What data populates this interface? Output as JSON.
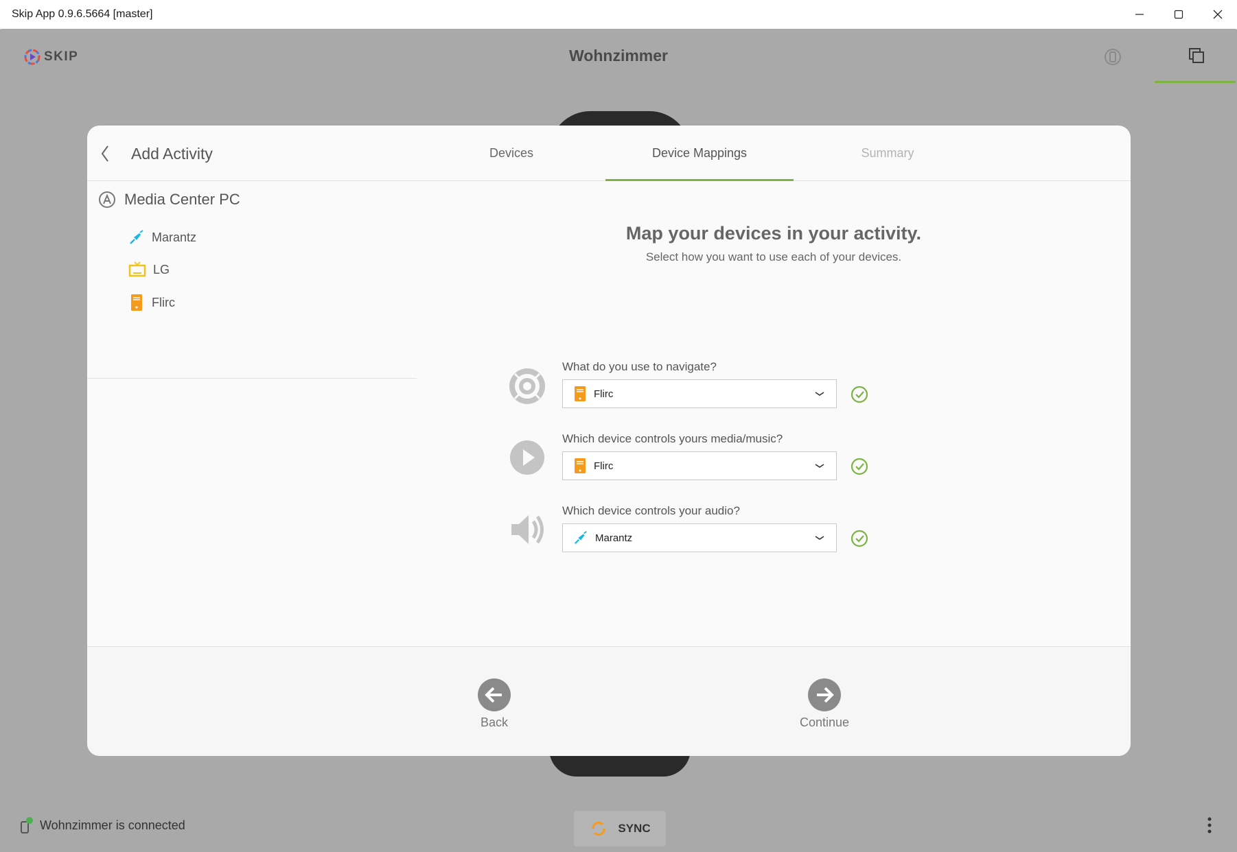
{
  "window": {
    "title": "Skip App 0.9.6.5664 [master]"
  },
  "header": {
    "logo_text": "SKIP",
    "room": "Wohnzimmer"
  },
  "modal": {
    "title": "Add Activity",
    "tabs": [
      {
        "label": "Devices",
        "state": "normal"
      },
      {
        "label": "Device Mappings",
        "state": "active"
      },
      {
        "label": "Summary",
        "state": "disabled"
      }
    ],
    "activity": {
      "name": "Media Center PC"
    },
    "devices": [
      {
        "label": "Marantz",
        "icon": "audio-cable-icon"
      },
      {
        "label": "LG",
        "icon": "tv-icon"
      },
      {
        "label": "Flirc",
        "icon": "media-box-icon"
      }
    ],
    "heading": "Map your devices in your activity.",
    "subheading": "Select how you want to use each of your devices.",
    "mappings": [
      {
        "question": "What do you use to navigate?",
        "selected": "Flirc",
        "icon": "navigate-icon"
      },
      {
        "question": "Which device controls yours media/music?",
        "selected": "Flirc",
        "icon": "play-icon"
      },
      {
        "question": "Which device controls your audio?",
        "selected": "Marantz",
        "icon": "speaker-icon"
      }
    ],
    "footer": {
      "back_label": "Back",
      "continue_label": "Continue"
    }
  },
  "statusbar": {
    "status_text": "Wohnzimmer is connected",
    "sync_label": "SYNC"
  },
  "colors": {
    "accent": "#7cb342",
    "device_orange": "#f59a1b",
    "device_yellow": "#f3c21a",
    "device_cyan": "#17b8e6"
  }
}
